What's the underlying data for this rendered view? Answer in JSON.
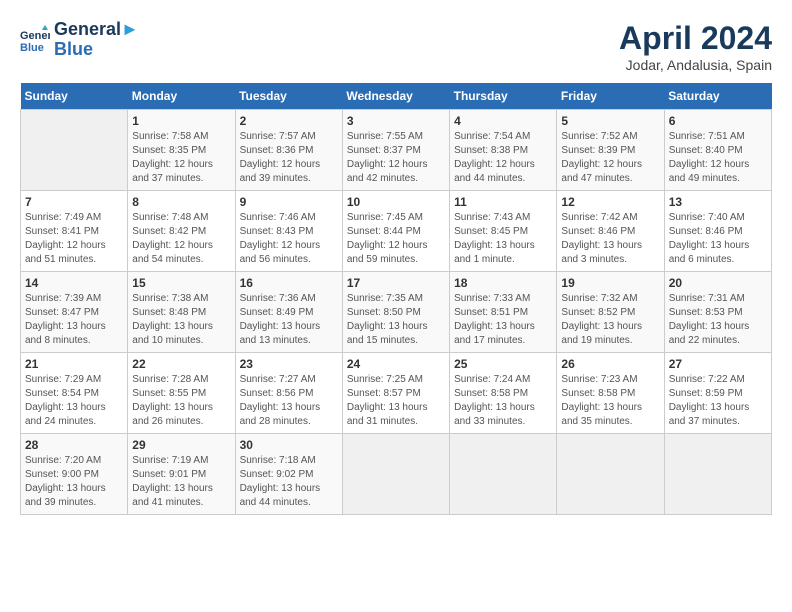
{
  "header": {
    "logo_line1": "General",
    "logo_line2": "Blue",
    "title": "April 2024",
    "subtitle": "Jodar, Andalusia, Spain"
  },
  "calendar": {
    "days_of_week": [
      "Sunday",
      "Monday",
      "Tuesday",
      "Wednesday",
      "Thursday",
      "Friday",
      "Saturday"
    ],
    "weeks": [
      [
        {
          "day": "",
          "content": ""
        },
        {
          "day": "1",
          "content": "Sunrise: 7:58 AM\nSunset: 8:35 PM\nDaylight: 12 hours and 37 minutes."
        },
        {
          "day": "2",
          "content": "Sunrise: 7:57 AM\nSunset: 8:36 PM\nDaylight: 12 hours and 39 minutes."
        },
        {
          "day": "3",
          "content": "Sunrise: 7:55 AM\nSunset: 8:37 PM\nDaylight: 12 hours and 42 minutes."
        },
        {
          "day": "4",
          "content": "Sunrise: 7:54 AM\nSunset: 8:38 PM\nDaylight: 12 hours and 44 minutes."
        },
        {
          "day": "5",
          "content": "Sunrise: 7:52 AM\nSunset: 8:39 PM\nDaylight: 12 hours and 47 minutes."
        },
        {
          "day": "6",
          "content": "Sunrise: 7:51 AM\nSunset: 8:40 PM\nDaylight: 12 hours and 49 minutes."
        }
      ],
      [
        {
          "day": "7",
          "content": "Sunrise: 7:49 AM\nSunset: 8:41 PM\nDaylight: 12 hours and 51 minutes."
        },
        {
          "day": "8",
          "content": "Sunrise: 7:48 AM\nSunset: 8:42 PM\nDaylight: 12 hours and 54 minutes."
        },
        {
          "day": "9",
          "content": "Sunrise: 7:46 AM\nSunset: 8:43 PM\nDaylight: 12 hours and 56 minutes."
        },
        {
          "day": "10",
          "content": "Sunrise: 7:45 AM\nSunset: 8:44 PM\nDaylight: 12 hours and 59 minutes."
        },
        {
          "day": "11",
          "content": "Sunrise: 7:43 AM\nSunset: 8:45 PM\nDaylight: 13 hours and 1 minute."
        },
        {
          "day": "12",
          "content": "Sunrise: 7:42 AM\nSunset: 8:46 PM\nDaylight: 13 hours and 3 minutes."
        },
        {
          "day": "13",
          "content": "Sunrise: 7:40 AM\nSunset: 8:46 PM\nDaylight: 13 hours and 6 minutes."
        }
      ],
      [
        {
          "day": "14",
          "content": "Sunrise: 7:39 AM\nSunset: 8:47 PM\nDaylight: 13 hours and 8 minutes."
        },
        {
          "day": "15",
          "content": "Sunrise: 7:38 AM\nSunset: 8:48 PM\nDaylight: 13 hours and 10 minutes."
        },
        {
          "day": "16",
          "content": "Sunrise: 7:36 AM\nSunset: 8:49 PM\nDaylight: 13 hours and 13 minutes."
        },
        {
          "day": "17",
          "content": "Sunrise: 7:35 AM\nSunset: 8:50 PM\nDaylight: 13 hours and 15 minutes."
        },
        {
          "day": "18",
          "content": "Sunrise: 7:33 AM\nSunset: 8:51 PM\nDaylight: 13 hours and 17 minutes."
        },
        {
          "day": "19",
          "content": "Sunrise: 7:32 AM\nSunset: 8:52 PM\nDaylight: 13 hours and 19 minutes."
        },
        {
          "day": "20",
          "content": "Sunrise: 7:31 AM\nSunset: 8:53 PM\nDaylight: 13 hours and 22 minutes."
        }
      ],
      [
        {
          "day": "21",
          "content": "Sunrise: 7:29 AM\nSunset: 8:54 PM\nDaylight: 13 hours and 24 minutes."
        },
        {
          "day": "22",
          "content": "Sunrise: 7:28 AM\nSunset: 8:55 PM\nDaylight: 13 hours and 26 minutes."
        },
        {
          "day": "23",
          "content": "Sunrise: 7:27 AM\nSunset: 8:56 PM\nDaylight: 13 hours and 28 minutes."
        },
        {
          "day": "24",
          "content": "Sunrise: 7:25 AM\nSunset: 8:57 PM\nDaylight: 13 hours and 31 minutes."
        },
        {
          "day": "25",
          "content": "Sunrise: 7:24 AM\nSunset: 8:58 PM\nDaylight: 13 hours and 33 minutes."
        },
        {
          "day": "26",
          "content": "Sunrise: 7:23 AM\nSunset: 8:58 PM\nDaylight: 13 hours and 35 minutes."
        },
        {
          "day": "27",
          "content": "Sunrise: 7:22 AM\nSunset: 8:59 PM\nDaylight: 13 hours and 37 minutes."
        }
      ],
      [
        {
          "day": "28",
          "content": "Sunrise: 7:20 AM\nSunset: 9:00 PM\nDaylight: 13 hours and 39 minutes."
        },
        {
          "day": "29",
          "content": "Sunrise: 7:19 AM\nSunset: 9:01 PM\nDaylight: 13 hours and 41 minutes."
        },
        {
          "day": "30",
          "content": "Sunrise: 7:18 AM\nSunset: 9:02 PM\nDaylight: 13 hours and 44 minutes."
        },
        {
          "day": "",
          "content": ""
        },
        {
          "day": "",
          "content": ""
        },
        {
          "day": "",
          "content": ""
        },
        {
          "day": "",
          "content": ""
        }
      ]
    ]
  }
}
